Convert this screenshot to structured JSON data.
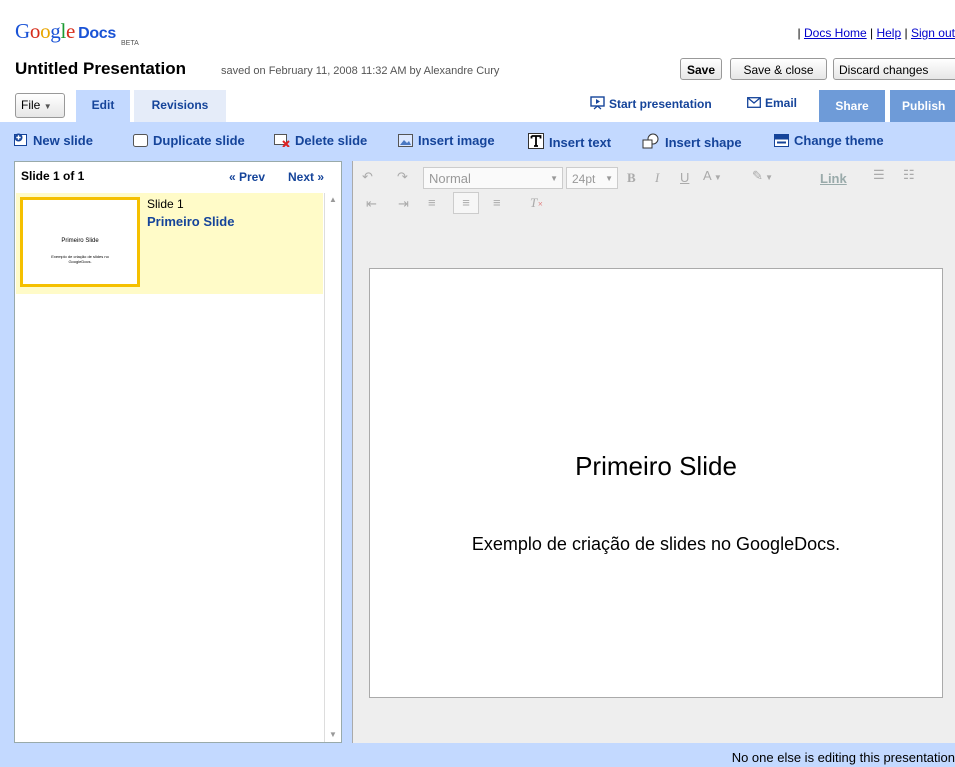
{
  "header": {
    "logo_google": "Google",
    "logo_docs": "Docs",
    "logo_beta": "BETA",
    "links": [
      "Docs Home",
      "Help",
      "Sign out"
    ],
    "title": "Untitled Presentation",
    "saved_text": "saved on February 11, 2008 11:32 AM by Alexandre Cury",
    "buttons": {
      "save": "Save",
      "save_close": "Save & close",
      "discard": "Discard changes"
    }
  },
  "tabs": {
    "file": "File",
    "edit": "Edit",
    "revisions": "Revisions",
    "start_presentation": "Start presentation",
    "email": "Email",
    "share": "Share",
    "publish": "Publish"
  },
  "toolbar": {
    "new_slide": "New slide",
    "duplicate_slide": "Duplicate slide",
    "delete_slide": "Delete slide",
    "insert_image": "Insert image",
    "insert_text": "Insert text",
    "insert_shape": "Insert shape",
    "change_theme": "Change theme"
  },
  "slides_panel": {
    "count": "Slide 1 of 1",
    "prev": "« Prev",
    "next": "Next »",
    "slides": [
      {
        "number": "Slide 1",
        "name": "Primeiro Slide",
        "thumb_title": "Primeiro Slide",
        "thumb_sub": "Exemplo de criação de slides no GoogleDocs."
      }
    ]
  },
  "format_bar": {
    "style": "Normal",
    "size": "24pt",
    "link": "Link"
  },
  "slide": {
    "title": "Primeiro Slide",
    "subtitle": "Exemplo de criação de slides no GoogleDocs."
  },
  "status": "No one else is editing this presentation",
  "colors": {
    "toolbar_bg": "#c3d9ff",
    "link": "#15449a",
    "selected_slide": "#fffbc8",
    "thumb_border": "#f5c000"
  }
}
